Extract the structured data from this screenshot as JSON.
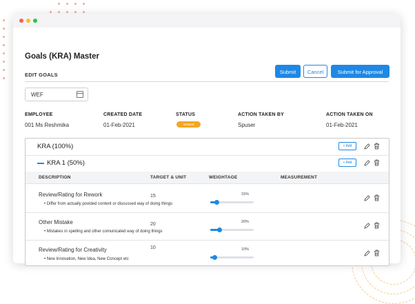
{
  "page": {
    "title": "Goals (KRA) Master",
    "section_title": "EDIT GOALS",
    "buttons": {
      "submit": "Submit",
      "cancel": "Cancel",
      "submit_approval": "Submit for Approval"
    }
  },
  "wef": {
    "label": "WEF",
    "icon": "calendar-icon"
  },
  "info": {
    "employee_label": "EMPLOYEE",
    "employee_value": "001 Ms Reshmika",
    "created_label": "CREATED DATE",
    "created_value": "01-Feb-2021",
    "status_label": "STATUS",
    "status_value": "Initiated",
    "action_by_label": "ACTION TAKEN BY",
    "action_by_value": "Spuser",
    "action_on_label": "ACTION TAKEN ON",
    "action_on_value": "01-Feb-2021"
  },
  "kra": {
    "label": "KRA (100%)",
    "add_label": "+ Add",
    "sub": {
      "label": "KRA 1 (50%)",
      "add_label": "+ Add"
    },
    "columns": {
      "description": "DESCRIPTION",
      "target": "TARGET & UNIT",
      "weightage": "WEIGHTAGE",
      "measurement": "MEASUREMENT"
    },
    "goals": [
      {
        "title": "Review/Rating for Rework",
        "description": "• Differ from actually povided content or discussed way of doing things",
        "target": "15",
        "weightage": 15,
        "weightage_label": "15%"
      },
      {
        "title": "Other Mistake",
        "description": "• Mistakes in spelling and other comunicated way of doing things",
        "target": "20",
        "weightage": 20,
        "weightage_label": "20%"
      },
      {
        "title": "Review/Rating for Creativity",
        "description": "• New Innovation, New Idea, New Concept etc",
        "target": "10",
        "weightage": 10,
        "weightage_label": "10%"
      }
    ]
  },
  "colors": {
    "accent": "#1e88e5",
    "status_badge": "#f5a623",
    "close_dot": "#fc5f57",
    "minimize_dot": "#fdbc2e",
    "maximize_dot": "#28c840"
  }
}
